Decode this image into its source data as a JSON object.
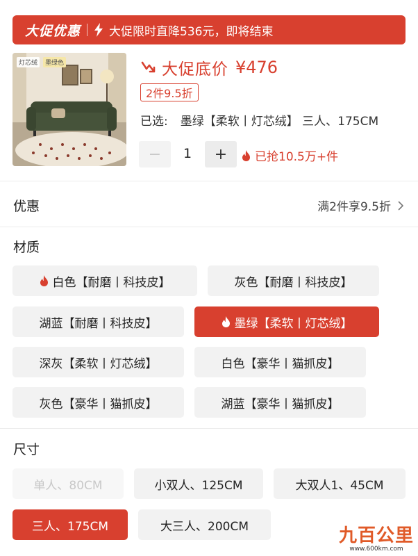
{
  "promo": {
    "brand": "大促优惠",
    "text": "大促限时直降536元，即将结束"
  },
  "product": {
    "image_tags": [
      "灯芯绒",
      "墨绿色"
    ],
    "price_label": "大促底价",
    "price_value": "¥476",
    "discount_badge": "2件9.5折",
    "selected_label": "已选:",
    "selected_value": "墨绿【柔软丨灯芯绒】 三人、175CM",
    "quantity": "1",
    "minus_symbol": "−",
    "plus_symbol": "+",
    "sold_text": "已抢10.5万+件"
  },
  "coupon": {
    "title": "优惠",
    "value": "满2件享9.5折"
  },
  "material": {
    "title": "材质",
    "options": [
      {
        "label": "白色【耐磨丨科技皮】",
        "hot": true,
        "state": "normal"
      },
      {
        "label": "灰色【耐磨丨科技皮】",
        "hot": false,
        "state": "normal"
      },
      {
        "label": "湖蓝【耐磨丨科技皮】",
        "hot": false,
        "state": "normal"
      },
      {
        "label": "墨绿【柔软丨灯芯绒】",
        "hot": true,
        "state": "selected"
      },
      {
        "label": "深灰【柔软丨灯芯绒】",
        "hot": false,
        "state": "normal"
      },
      {
        "label": "白色【豪华丨猫抓皮】",
        "hot": false,
        "state": "normal"
      },
      {
        "label": "灰色【豪华丨猫抓皮】",
        "hot": false,
        "state": "normal"
      },
      {
        "label": "湖蓝【豪华丨猫抓皮】",
        "hot": false,
        "state": "normal"
      }
    ]
  },
  "size": {
    "title": "尺寸",
    "options": [
      {
        "label": "单人、80CM",
        "state": "disabled"
      },
      {
        "label": "小双人、125CM",
        "state": "normal"
      },
      {
        "label": "大双人1、45CM",
        "state": "normal"
      },
      {
        "label": "三人、175CM",
        "state": "selected"
      },
      {
        "label": "大三人、200CM",
        "state": "normal"
      }
    ]
  },
  "watermark": {
    "logo": "九百公里",
    "url": "www.600km.com"
  },
  "colors": {
    "accent": "#d8402f",
    "chip_bg": "#f2f2f2",
    "disabled_text": "#c8c8c8"
  },
  "icons": [
    "lightning-icon",
    "price-down-arrow-icon",
    "flame-icon",
    "chevron-right-icon"
  ]
}
